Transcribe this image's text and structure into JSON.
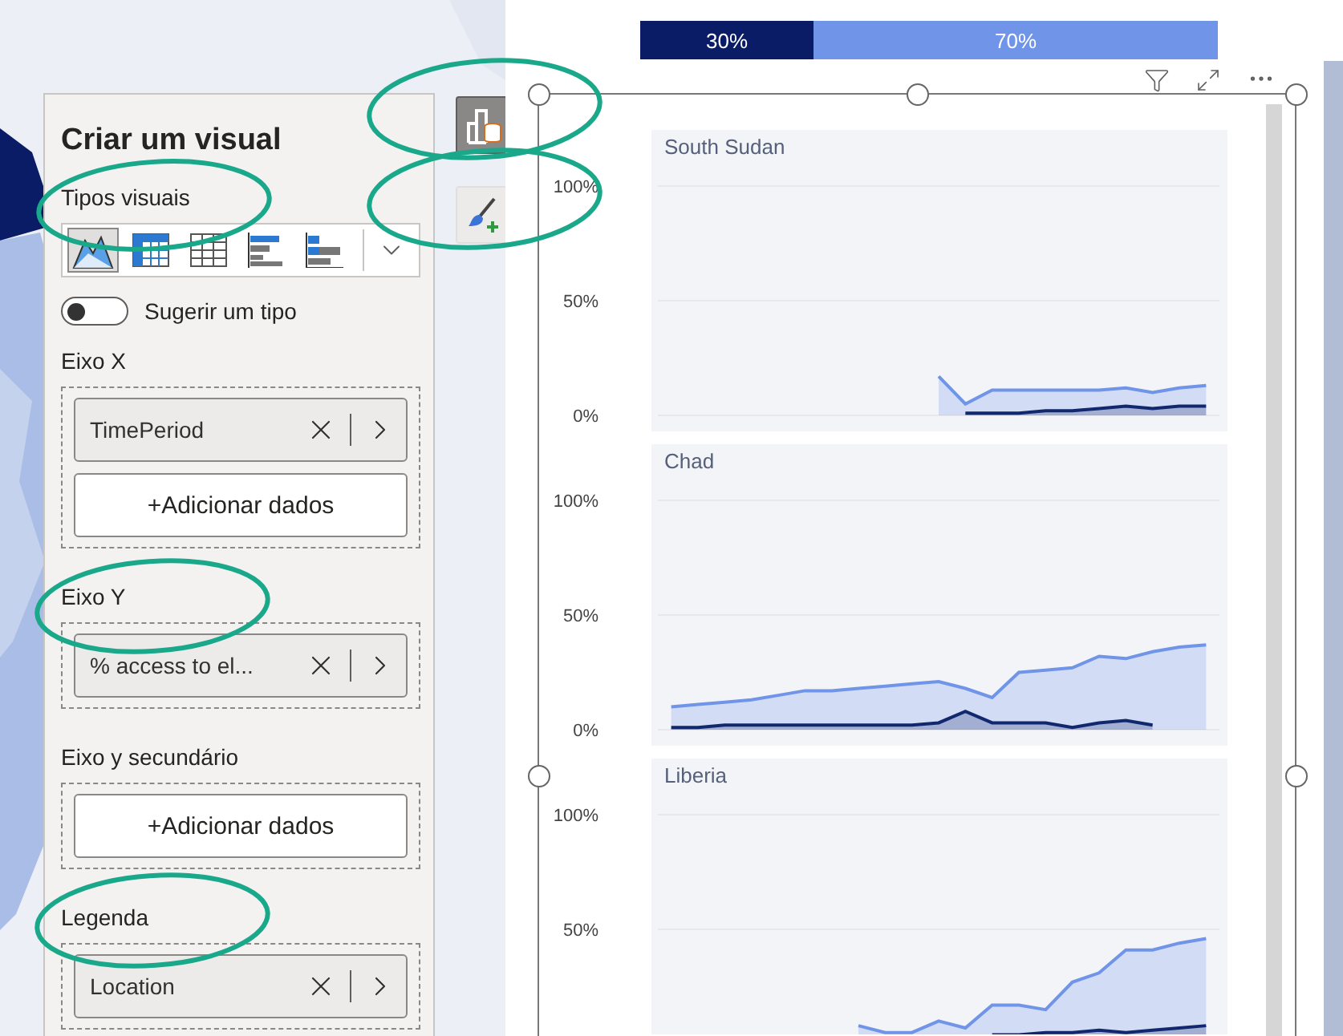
{
  "panel": {
    "title": "Criar um visual",
    "visual_types": {
      "label": "Tipos visuais",
      "items": [
        {
          "kind": "area",
          "selected": true
        },
        {
          "kind": "matrix",
          "selected": false
        },
        {
          "kind": "table",
          "selected": false
        },
        {
          "kind": "bar",
          "selected": false
        },
        {
          "kind": "stacked-bar",
          "selected": false
        }
      ]
    },
    "suggest": {
      "label": "Sugerir um tipo",
      "on": false
    },
    "wells": [
      {
        "label": "Eixo X",
        "field": "TimePeriod",
        "add_label": "+Adicionar dados"
      },
      {
        "label": "Eixo Y",
        "field": "% access to el..."
      },
      {
        "label": "Eixo y secundário",
        "add_label": "+Adicionar dados"
      },
      {
        "label": "Legenda",
        "field": "Location"
      }
    ]
  },
  "side_buttons": [
    {
      "kind": "build",
      "selected": true
    },
    {
      "kind": "format",
      "selected": false
    }
  ],
  "share_bar": [
    {
      "label": "30%",
      "level": 0.3,
      "color": "#0b1c66"
    },
    {
      "label": "70%",
      "level": 0.7,
      "color": "#6f94e8"
    }
  ],
  "visual": {
    "charts": [
      {
        "chart_data": {
          "type": "area",
          "title": "South Sudan",
          "categories": [
            null,
            null,
            null,
            null,
            null,
            null,
            null,
            null,
            null,
            null,
            null,
            null,
            null,
            null,
            null,
            null,
            null,
            null,
            null,
            null,
            null
          ],
          "ylim": [
            0,
            100
          ],
          "yticks": [
            {
              "value": 0,
              "label": "0%"
            },
            {
              "value": 50,
              "label": "50%"
            },
            {
              "value": 100,
              "label": "100%"
            }
          ],
          "series": [
            {
              "color": "#6f94e8",
              "values": [
                null,
                null,
                null,
                null,
                null,
                null,
                null,
                null,
                null,
                null,
                17,
                5,
                11,
                11,
                11,
                11,
                11,
                12,
                10,
                12,
                13
              ]
            },
            {
              "color": "#12286e",
              "values": [
                null,
                null,
                null,
                null,
                null,
                null,
                null,
                null,
                null,
                null,
                null,
                1,
                1,
                1,
                2,
                2,
                3,
                4,
                3,
                4,
                4
              ]
            }
          ]
        }
      },
      {
        "chart_data": {
          "type": "area",
          "title": "Chad",
          "categories": [
            null,
            null,
            null,
            null,
            null,
            null,
            null,
            null,
            null,
            null,
            null,
            null,
            null,
            null,
            null,
            null,
            null,
            null,
            null,
            null,
            null
          ],
          "ylim": [
            0,
            100
          ],
          "yticks": [
            {
              "value": 0,
              "label": "0%"
            },
            {
              "value": 50,
              "label": "50%"
            },
            {
              "value": 100,
              "label": "100%"
            }
          ],
          "series": [
            {
              "color": "#6f94e8",
              "values": [
                10,
                11,
                12,
                13,
                15,
                17,
                17,
                18,
                19,
                20,
                21,
                18,
                14,
                25,
                26,
                27,
                32,
                31,
                34,
                36,
                37
              ]
            },
            {
              "color": "#12286e",
              "values": [
                1,
                1,
                2,
                2,
                2,
                2,
                2,
                2,
                2,
                2,
                3,
                8,
                3,
                3,
                3,
                1,
                3,
                4,
                2,
                null,
                null
              ]
            }
          ]
        }
      },
      {
        "chart_data": {
          "type": "area",
          "title": "Liberia",
          "categories": [
            null,
            null,
            null,
            null,
            null,
            null,
            null,
            null,
            null,
            null,
            null,
            null,
            null,
            null,
            null,
            null,
            null,
            null,
            null,
            null,
            null
          ],
          "ylim": [
            0,
            100
          ],
          "yticks": [
            {
              "value": 50,
              "label": "50%"
            },
            {
              "value": 100,
              "label": "100%"
            }
          ],
          "series": [
            {
              "color": "#6f94e8",
              "values": [
                null,
                null,
                null,
                null,
                null,
                null,
                null,
                8,
                5,
                5,
                10,
                7,
                17,
                17,
                15,
                27,
                31,
                41,
                41,
                44,
                46
              ]
            },
            {
              "color": "#12286e",
              "values": [
                null,
                null,
                null,
                null,
                null,
                null,
                null,
                null,
                null,
                null,
                null,
                null,
                4,
                4,
                5,
                5,
                6,
                5,
                6,
                7,
                8
              ]
            }
          ]
        }
      }
    ]
  }
}
